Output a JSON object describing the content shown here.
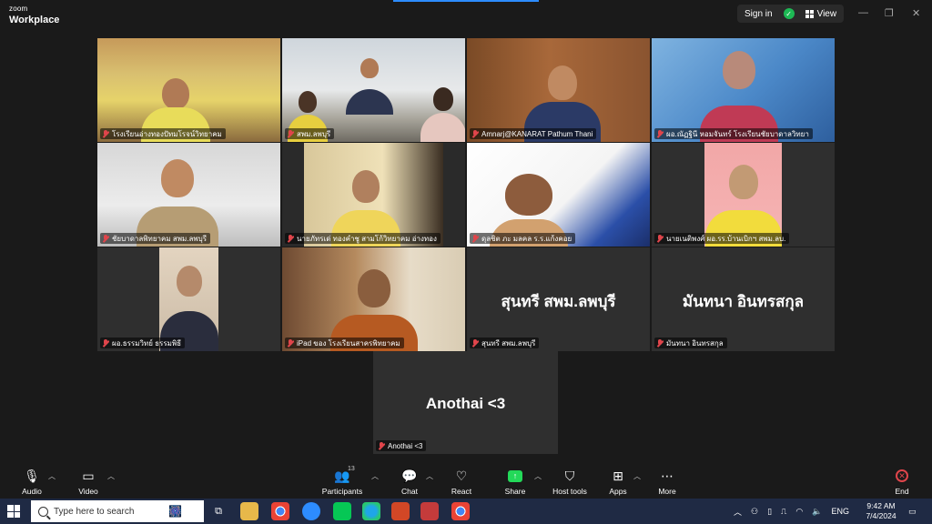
{
  "app": {
    "brand_line1": "zoom",
    "brand_line2": "Workplace"
  },
  "header": {
    "sign_in_label": "Sign in",
    "view_label": "View"
  },
  "gallery": {
    "tiles": [
      {
        "name": "โรงเรียนอ่างทองปัทมโรจน์วิทยาคม"
      },
      {
        "name": "สพม.ลพบุรี"
      },
      {
        "name": "Amnarj@KANARAT Pathum Thani"
      },
      {
        "name": "ผอ.ณัฏฐินี หอมจันทร์ โรงเรียนชัยบาดาลวิทยา"
      },
      {
        "name": "ชัยบาดาลพิทยาคม สพม.ลพบุรี"
      },
      {
        "name": "นายภัทรเด่ ทองคำชู สามโก้วิทยาคม อ่างทอง"
      },
      {
        "name": "ดุลชิต ภะ มลคล ร.ร.แก้งคอย"
      },
      {
        "name": "นายเนติพงศ์ ผอ.รร.บ้านเบิกฯ สพม.ลบ."
      },
      {
        "name": "ผอ.ธรรมวิทย์ ธรรมพิธี"
      },
      {
        "name": "iPad ของ โรงเรียนสาครพิทยาคม"
      },
      {
        "name": "สุนทรี สพม.ลพบุรี",
        "display_name": "สุนทรี สพม.ลพบุรี"
      },
      {
        "name": "มันทนา อินทรสกุล",
        "display_name": "มันทนา อินทรสกุล"
      }
    ],
    "overflow_tile": {
      "name": "Anothai <3",
      "display_name": "Anothai <3"
    }
  },
  "toolbar": {
    "audio": "Audio",
    "video": "Video",
    "participants": "Participants",
    "participants_count": "13",
    "chat": "Chat",
    "react": "React",
    "share": "Share",
    "host_tools": "Host tools",
    "apps": "Apps",
    "more": "More",
    "end": "End"
  },
  "taskbar": {
    "search_placeholder": "Type here to search",
    "language": "ENG",
    "time": "9:42 AM",
    "date": "7/4/2024"
  },
  "colors": {
    "active_speaker": "#23d959",
    "muted": "#e0454b",
    "share": "#23d959",
    "end": "#e0454b",
    "zoom_blue": "#2d8cff"
  }
}
